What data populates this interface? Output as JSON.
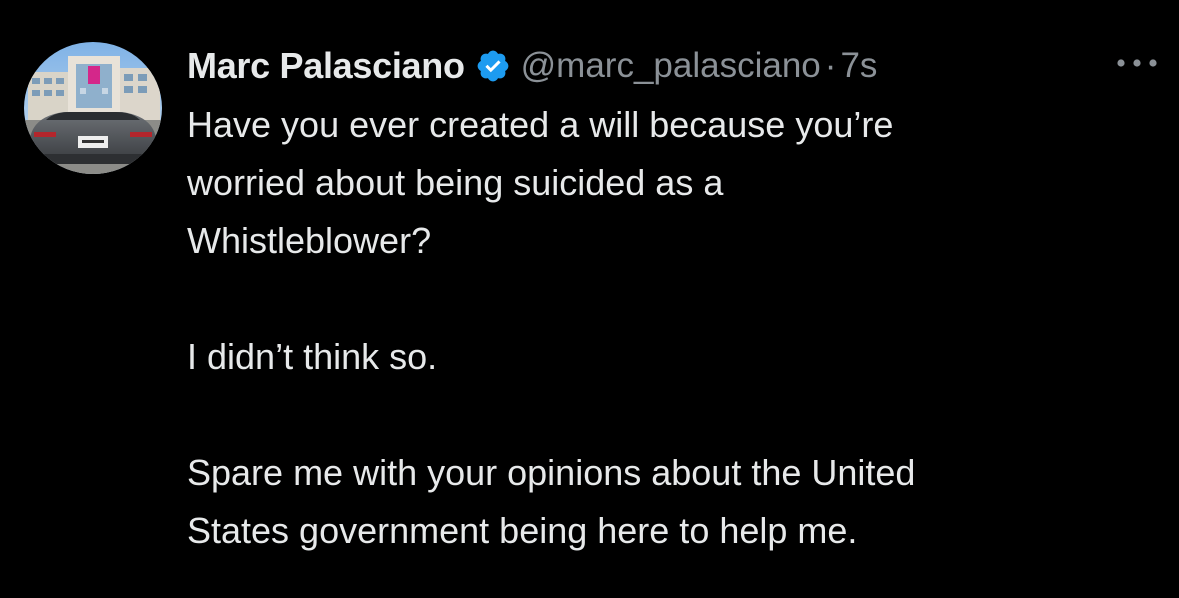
{
  "tweet": {
    "author": {
      "name": "Marc Palasciano",
      "handle": "@marc_palasciano",
      "verified": true,
      "avatar": "building-and-car-photo"
    },
    "separator": "·",
    "timestamp": "7s",
    "more_icon": "more-horizontal-icon",
    "paragraphs": [
      [
        "Have you ever created a will because you’re",
        "worried about being suicided as a",
        "Whistleblower?"
      ],
      [
        "I didn’t think so."
      ],
      [
        "Spare me with your opinions about the United",
        "States government being here to help me."
      ]
    ]
  },
  "colors": {
    "background": "#000000",
    "text": "#e7e9ea",
    "secondary": "#8b9197",
    "verified": "#1d9bf0"
  }
}
